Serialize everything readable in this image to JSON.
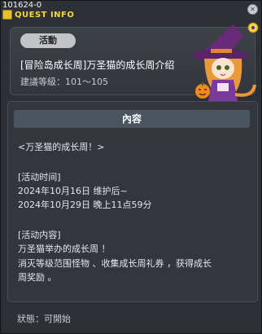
{
  "quest_id": "101624-0",
  "window_title": "QUEST INFO",
  "header": {
    "badge": "活動",
    "title": "[冒险岛成长周]万圣猫的成长周介绍",
    "level_requirement": "建議等級：101～105"
  },
  "content": {
    "heading": "內容",
    "lines": [
      "<万圣猫的成长周！>",
      "",
      "[活动时间]",
      "2024年10月16日 维护后~",
      "2024年10月29日 晚上11点59分",
      "",
      "[活动内容]",
      "万圣猫举办的成长周 ！",
      "消灭等级范围怪物 、收集成长周礼券 ，获得成长",
      "周奖励 。"
    ]
  },
  "status": "狀態：可開始",
  "colors": {
    "title_accent": "#f4d648",
    "panel_bg": "#33363c",
    "content_header_bg": "#4a5560"
  },
  "icons": [
    "quest-book-icon",
    "close-icon",
    "witch-cat-portrait"
  ]
}
